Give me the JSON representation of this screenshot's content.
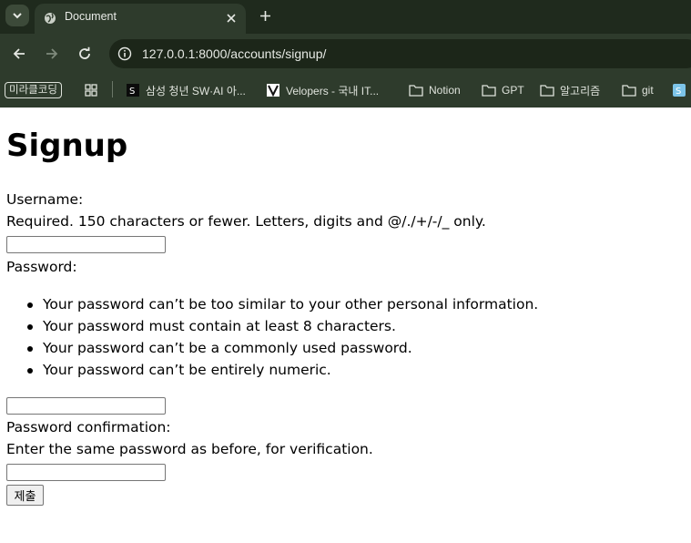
{
  "browser": {
    "tab": {
      "title": "Document"
    },
    "url": "127.0.0.1:8000/accounts/signup/",
    "bookmarks": [
      {
        "label": "미라클코딩",
        "icon": "pill"
      },
      {
        "label": "",
        "icon": "apps-grid-icon"
      },
      {
        "label": "삼성 청년 SW·AI 아...",
        "icon": "ssafy-icon"
      },
      {
        "label": "Velopers - 국내 IT...",
        "icon": "velopers-icon"
      },
      {
        "label": "Notion",
        "icon": "folder-icon"
      },
      {
        "label": "GPT",
        "icon": "folder-icon"
      },
      {
        "label": "알고리즘",
        "icon": "folder-icon"
      },
      {
        "label": "git",
        "icon": "folder-icon"
      }
    ],
    "colors": {
      "frame": "#1f2a1d",
      "toolbar": "#2e3b2c",
      "omnibox": "#1c2619"
    }
  },
  "form": {
    "title": "Signup",
    "username_label": "Username:",
    "username_help": "Required. 150 characters or fewer. Letters, digits and @/./+/-/_ only.",
    "username_value": "",
    "password_label": "Password:",
    "password_rules": [
      "Your password can’t be too similar to your other personal information.",
      "Your password must contain at least 8 characters.",
      "Your password can’t be a commonly used password.",
      "Your password can’t be entirely numeric."
    ],
    "password_value": "",
    "confirm_label": "Password confirmation:",
    "confirm_help": "Enter the same password as before, for verification.",
    "confirm_value": "",
    "submit_label": "제출"
  }
}
